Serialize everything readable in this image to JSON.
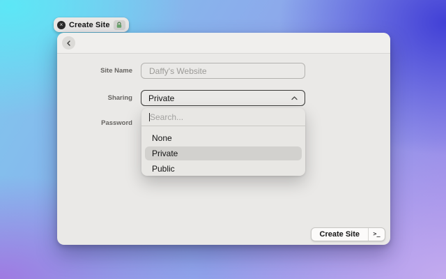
{
  "tab": {
    "title": "Create Site",
    "close_icon": "x-in-dark-circle",
    "lock_icon": "green-lock"
  },
  "window": {
    "header": {
      "back_icon": "chevron-left"
    },
    "form": {
      "site_name": {
        "label": "Site Name",
        "value": "",
        "placeholder": "Daffy's Website"
      },
      "sharing": {
        "label": "Sharing",
        "value": "Private",
        "chevron_icon": "chevron-up"
      },
      "password": {
        "label": "Password"
      }
    },
    "dropdown": {
      "search": {
        "value": "",
        "placeholder": "Search..."
      },
      "options": [
        {
          "label": "None",
          "selected": false
        },
        {
          "label": "Private",
          "selected": true
        },
        {
          "label": "Public",
          "selected": false
        }
      ]
    },
    "footer": {
      "create_label": "Create Site",
      "aux_glyph": ">_",
      "aux_icon": "terminal-prompt"
    }
  },
  "colors": {
    "wallpaper_cyan": "#5ce7f6",
    "wallpaper_blue": "#4140d6",
    "wallpaper_purple": "#9f7ae2",
    "wallpaper_lavender": "#c3abef",
    "window_bg": "#eae9e7",
    "dropdown_highlight": "#d2d1ce",
    "lock_green": "#69a56b"
  }
}
